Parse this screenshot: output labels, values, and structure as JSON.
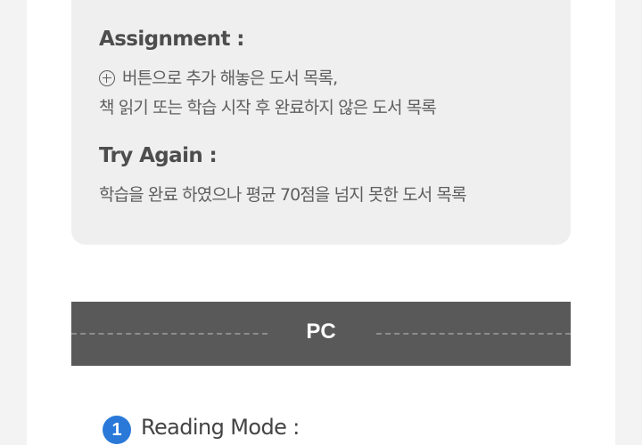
{
  "assignment": {
    "heading": "Assignment :",
    "line1": "버튼으로 추가 해놓은 도서 목록,",
    "line2": "책 읽기 또는 학습 시작 후 완료하지 않은 도서 목록"
  },
  "try_again": {
    "heading": "Try Again :",
    "line1": "학습을 완료 하였으나 평균 70점을 넘지 못한 도서 목록"
  },
  "pc_section": {
    "label": "PC"
  },
  "reading_mode": {
    "number": "1",
    "title": "Reading Mode :"
  },
  "colors": {
    "card_bg": "#efefef",
    "bar_bg": "#595959",
    "badge_blue": "#2a79d9"
  },
  "icons": [
    "plus-circle-icon"
  ]
}
